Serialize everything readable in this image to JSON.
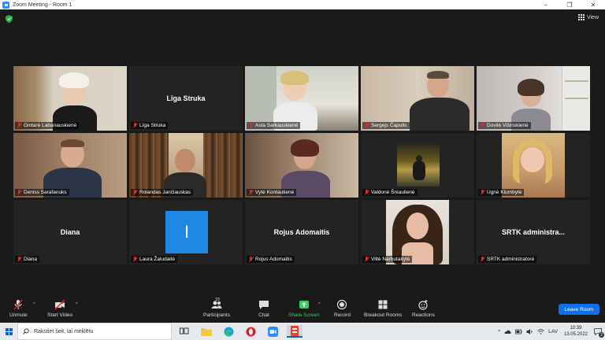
{
  "window": {
    "title": "Zoom Meeting - Room 1",
    "controls": [
      "–",
      "❐",
      "✕"
    ]
  },
  "topbar": {
    "view_label": "View"
  },
  "participants": [
    {
      "name": "Gintarė Labanauskienė",
      "video": true,
      "muted": true,
      "active": false
    },
    {
      "name": "Līga Struka",
      "display_name": "Līga Struka",
      "video": false,
      "muted": true,
      "active": false
    },
    {
      "name": "Asta Sarkauskienė",
      "video": true,
      "muted": true,
      "active": false
    },
    {
      "name": "Sergejs Čapulis",
      "video": true,
      "muted": true,
      "active": false
    },
    {
      "name": "Dovilė Višinskienė",
      "video": true,
      "muted": true,
      "active": true
    },
    {
      "name": "Deniss Sarafanuks",
      "video": true,
      "muted": true,
      "active": false
    },
    {
      "name": "Rolandas Jančiauskas",
      "video": true,
      "muted": true,
      "active": false
    },
    {
      "name": "Vytė Kontautienė",
      "video": true,
      "muted": true,
      "active": false
    },
    {
      "name": "Valdonė Šniaulienė",
      "video": true,
      "muted": true,
      "active": false
    },
    {
      "name": "Ugnė Klumbytė",
      "video": true,
      "muted": true,
      "active": false
    },
    {
      "name": "Diana",
      "display_name": "Diana",
      "video": false,
      "muted": true,
      "active": false
    },
    {
      "name": "Laura Žaludaitė",
      "avatar_letter": "I",
      "video": false,
      "muted": true,
      "active": false
    },
    {
      "name": "Rojus Adomaitis",
      "display_name": "Rojus Adomaitis",
      "video": false,
      "muted": true,
      "active": false
    },
    {
      "name": "Viltė Narbutaitytė",
      "video": true,
      "muted": true,
      "active": false
    },
    {
      "name": "SRTK administratorė",
      "display_name": "SRTK administra...",
      "video": false,
      "muted": true,
      "active": false
    }
  ],
  "toolbar": {
    "unmute": "Unmute",
    "start_video": "Start Video",
    "participants": "Participants",
    "participants_count": "15",
    "chat": "Chat",
    "share_screen": "Share Screen",
    "record": "Record",
    "breakout_rooms": "Breakout Rooms",
    "reactions": "Reactions",
    "leave": "Leave Room"
  },
  "taskbar": {
    "search_placeholder": "Rakstiet šeit, lai meklētu",
    "language": "LAV",
    "time": "10:39",
    "date": "13.05.2022",
    "notifications": "2"
  },
  "colors": {
    "active_speaker": "#a6d93a",
    "leave_button": "#0e71eb",
    "share_screen": "#2fd35e",
    "muted_icon": "#e02828",
    "avatar_bg": "#1e88e5"
  }
}
